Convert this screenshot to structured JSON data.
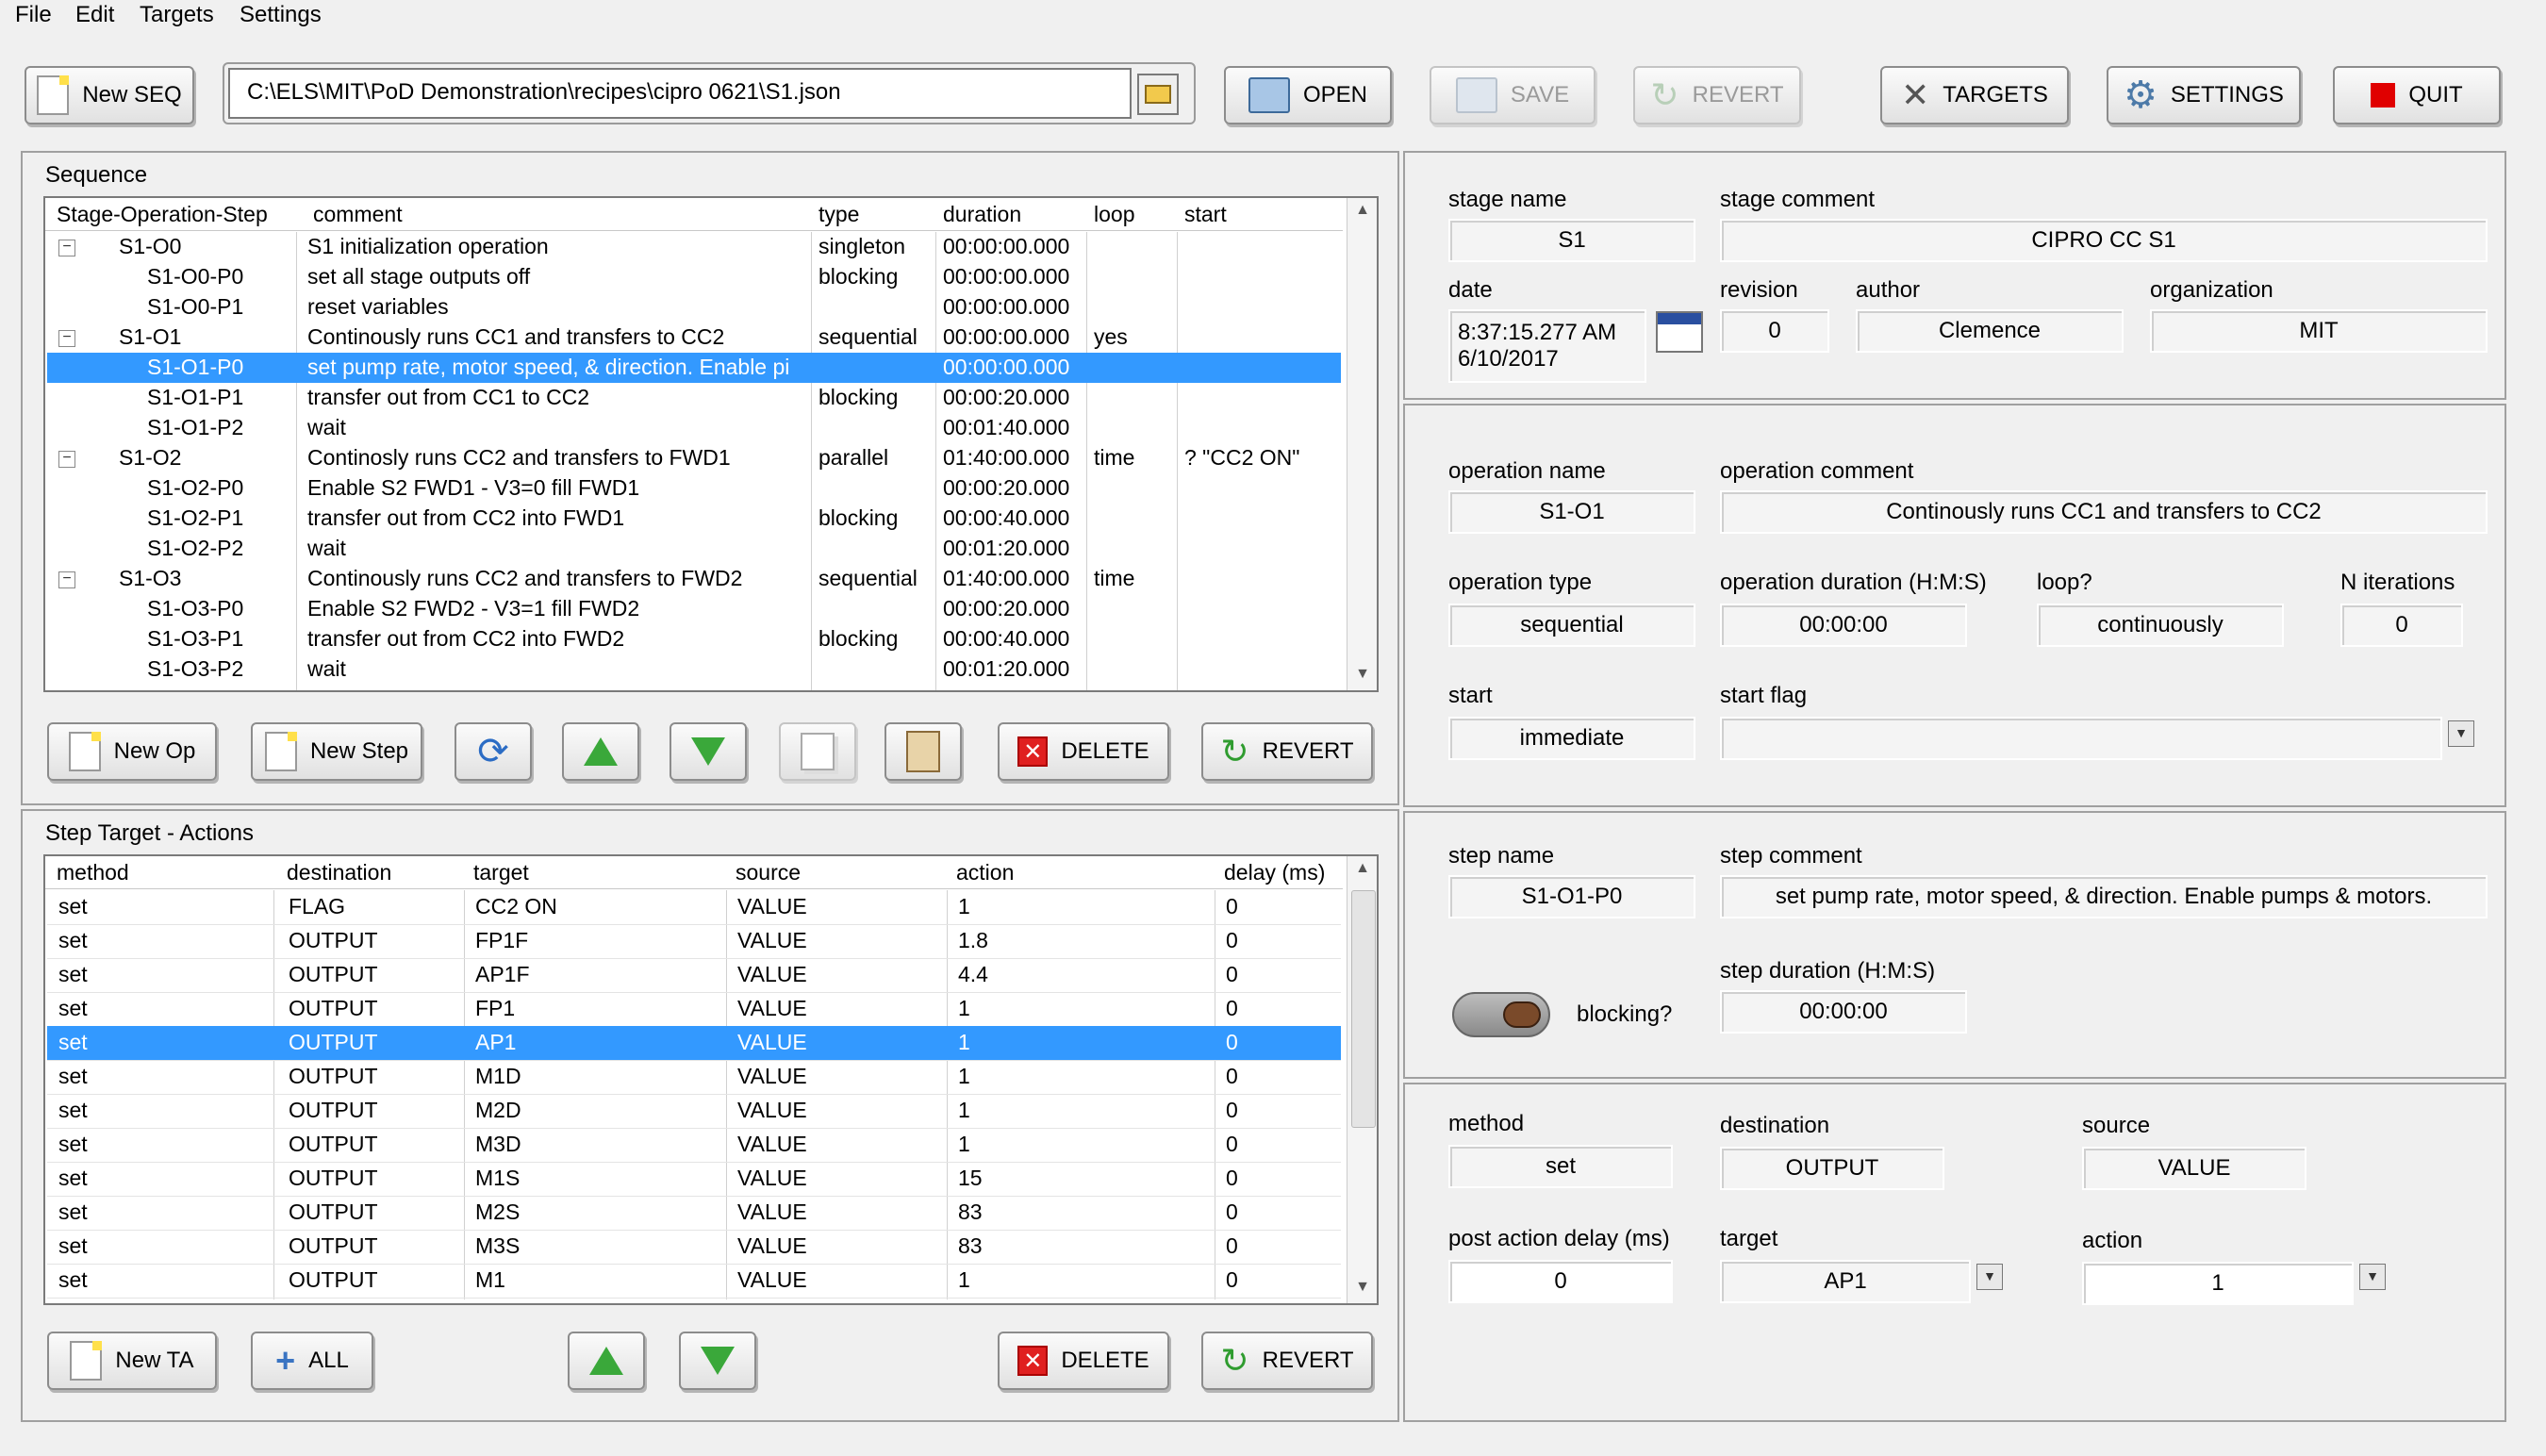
{
  "menu": [
    "File",
    "Edit",
    "Targets",
    "Settings"
  ],
  "toolbar": {
    "new_seq": "New SEQ",
    "path": "C:\\ELS\\MIT\\PoD Demonstration\\recipes\\cipro 0621\\S1.json",
    "open": "OPEN",
    "save": "SAVE",
    "revert": "REVERT",
    "targets": "TARGETS",
    "settings": "SETTINGS",
    "quit": "QUIT"
  },
  "sequence": {
    "title": "Sequence",
    "columns": [
      "Stage-Operation-Step",
      "comment",
      "type",
      "duration",
      "loop",
      "start"
    ],
    "rows": [
      {
        "level": 1,
        "expander": "⊟",
        "name": "S1-O0",
        "comment": "S1 initialization operation",
        "type": "singleton",
        "duration": "00:00:00.000",
        "loop": "",
        "start": ""
      },
      {
        "level": 2,
        "expander": "",
        "name": "S1-O0-P0",
        "comment": "set all stage outputs off",
        "type": "blocking",
        "duration": "00:00:00.000",
        "loop": "",
        "start": ""
      },
      {
        "level": 2,
        "expander": "",
        "name": "S1-O0-P1",
        "comment": "reset variables",
        "type": "",
        "duration": "00:00:00.000",
        "loop": "",
        "start": ""
      },
      {
        "level": 1,
        "expander": "⊟",
        "name": "S1-O1",
        "comment": "Continously runs CC1 and transfers to CC2",
        "type": "sequential",
        "duration": "00:00:00.000",
        "loop": "yes",
        "start": ""
      },
      {
        "level": 2,
        "expander": "",
        "name": "S1-O1-P0",
        "comment": "set pump rate, motor speed, & direction. Enable pi",
        "type": "",
        "duration": "00:00:00.000",
        "loop": "",
        "start": "",
        "selected": true
      },
      {
        "level": 2,
        "expander": "",
        "name": "S1-O1-P1",
        "comment": "transfer out from CC1 to CC2",
        "type": "blocking",
        "duration": "00:00:20.000",
        "loop": "",
        "start": ""
      },
      {
        "level": 2,
        "expander": "",
        "name": "S1-O1-P2",
        "comment": "wait",
        "type": "",
        "duration": "00:01:40.000",
        "loop": "",
        "start": ""
      },
      {
        "level": 1,
        "expander": "⊟",
        "name": "S1-O2",
        "comment": "Continosly runs CC2 and transfers to FWD1",
        "type": "parallel",
        "duration": "01:40:00.000",
        "loop": "time",
        "start": "? \"CC2 ON\""
      },
      {
        "level": 2,
        "expander": "",
        "name": "S1-O2-P0",
        "comment": "Enable S2 FWD1 - V3=0 fill FWD1",
        "type": "",
        "duration": "00:00:20.000",
        "loop": "",
        "start": ""
      },
      {
        "level": 2,
        "expander": "",
        "name": "S1-O2-P1",
        "comment": "transfer out from CC2 into FWD1",
        "type": "blocking",
        "duration": "00:00:40.000",
        "loop": "",
        "start": ""
      },
      {
        "level": 2,
        "expander": "",
        "name": "S1-O2-P2",
        "comment": "wait",
        "type": "",
        "duration": "00:01:20.000",
        "loop": "",
        "start": ""
      },
      {
        "level": 1,
        "expander": "⊟",
        "name": "S1-O3",
        "comment": "Continously runs CC2 and transfers to FWD2",
        "type": "sequential",
        "duration": "01:40:00.000",
        "loop": "time",
        "start": ""
      },
      {
        "level": 2,
        "expander": "",
        "name": "S1-O3-P0",
        "comment": "Enable S2 FWD2 - V3=1 fill FWD2",
        "type": "",
        "duration": "00:00:20.000",
        "loop": "",
        "start": ""
      },
      {
        "level": 2,
        "expander": "",
        "name": "S1-O3-P1",
        "comment": "transfer out from CC2 into FWD2",
        "type": "blocking",
        "duration": "00:00:40.000",
        "loop": "",
        "start": ""
      },
      {
        "level": 2,
        "expander": "",
        "name": "S1-O3-P2",
        "comment": "wait",
        "type": "",
        "duration": "00:01:20.000",
        "loop": "",
        "start": ""
      }
    ],
    "buttons": {
      "new_op": "New Op",
      "new_step": "New Step",
      "delete": "DELETE",
      "revert": "REVERT"
    }
  },
  "actions": {
    "title": "Step Target - Actions",
    "columns": [
      "method",
      "destination",
      "target",
      "source",
      "action",
      "delay (ms)"
    ],
    "rows": [
      [
        "set",
        "FLAG",
        "CC2 ON",
        "VALUE",
        "1",
        "0"
      ],
      [
        "set",
        "OUTPUT",
        "FP1F",
        "VALUE",
        "1.8",
        "0"
      ],
      [
        "set",
        "OUTPUT",
        "AP1F",
        "VALUE",
        "4.4",
        "0"
      ],
      [
        "set",
        "OUTPUT",
        "FP1",
        "VALUE",
        "1",
        "0"
      ],
      [
        "set",
        "OUTPUT",
        "AP1",
        "VALUE",
        "1",
        "0"
      ],
      [
        "set",
        "OUTPUT",
        "M1D",
        "VALUE",
        "1",
        "0"
      ],
      [
        "set",
        "OUTPUT",
        "M2D",
        "VALUE",
        "1",
        "0"
      ],
      [
        "set",
        "OUTPUT",
        "M3D",
        "VALUE",
        "1",
        "0"
      ],
      [
        "set",
        "OUTPUT",
        "M1S",
        "VALUE",
        "15",
        "0"
      ],
      [
        "set",
        "OUTPUT",
        "M2S",
        "VALUE",
        "83",
        "0"
      ],
      [
        "set",
        "OUTPUT",
        "M3S",
        "VALUE",
        "83",
        "0"
      ],
      [
        "set",
        "OUTPUT",
        "M1",
        "VALUE",
        "1",
        "0"
      ]
    ],
    "selected_index": 4,
    "buttons": {
      "new_ta": "New TA",
      "all": "ALL",
      "delete": "DELETE",
      "revert": "REVERT"
    }
  },
  "stage": {
    "name_label": "stage name",
    "name": "S1",
    "comment_label": "stage comment",
    "comment": "CIPRO CC S1",
    "date_label": "date",
    "time": "8:37:15.277 AM",
    "date": "6/10/2017",
    "revision_label": "revision",
    "revision": "0",
    "author_label": "author",
    "author": "Clemence",
    "org_label": "organization",
    "org": "MIT"
  },
  "operation": {
    "name_label": "operation name",
    "name": "S1-O1",
    "comment_label": "operation comment",
    "comment": "Continously runs CC1 and transfers to CC2",
    "type_label": "operation type",
    "type": "sequential",
    "duration_label": "operation duration (H:M:S)",
    "duration": "00:00:00",
    "loop_label": "loop?",
    "loop": "continuously",
    "iter_label": "N iterations",
    "iterations": "0",
    "start_label": "start",
    "start": "immediate",
    "flag_label": "start flag",
    "flag": ""
  },
  "step": {
    "name_label": "step name",
    "name": "S1-O1-P0",
    "comment_label": "step comment",
    "comment": "set pump rate, motor speed, & direction. Enable pumps & motors.",
    "blocking_label": "blocking?",
    "duration_label": "step duration (H:M:S)",
    "duration": "00:00:00"
  },
  "action_detail": {
    "method_label": "method",
    "method": "set",
    "destination_label": "destination",
    "destination": "OUTPUT",
    "source_label": "source",
    "source": "VALUE",
    "delay_label": "post action delay (ms)",
    "delay": "0",
    "target_label": "target",
    "target": "AP1",
    "action_label": "action",
    "action": "1"
  },
  "icons": [
    "document-icon",
    "folder-icon",
    "open-folder-icon",
    "save-icon",
    "revert-icon",
    "tools-icon",
    "gear-icon",
    "quit-icon",
    "refresh-icon",
    "up-arrow-icon",
    "down-arrow-icon",
    "copy-icon",
    "paste-icon",
    "delete-icon",
    "plus-icon",
    "calendar-icon"
  ]
}
